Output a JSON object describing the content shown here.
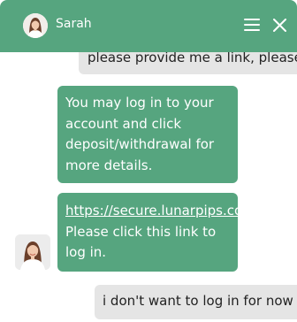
{
  "header": {
    "agent_name": "Sarah",
    "background": "#56a57f",
    "icons": [
      "agent-avatar",
      "menu-icon",
      "close-icon"
    ]
  },
  "messages": [
    {
      "sender": "user",
      "text": "please provide me a link, please"
    },
    {
      "sender": "agent",
      "text": "You may log in to your account and click deposit/withdrawal for more details."
    },
    {
      "sender": "agent",
      "link": "https://secure.lunarpips.com/login",
      "text": " Please click this link to log in."
    },
    {
      "sender": "user",
      "text": "i don't want to log in for now"
    }
  ],
  "colors": {
    "agent_bubble": "#56a57f",
    "user_bubble": "#e5e5e5",
    "agent_text": "#ffffff",
    "user_text": "#222222"
  }
}
